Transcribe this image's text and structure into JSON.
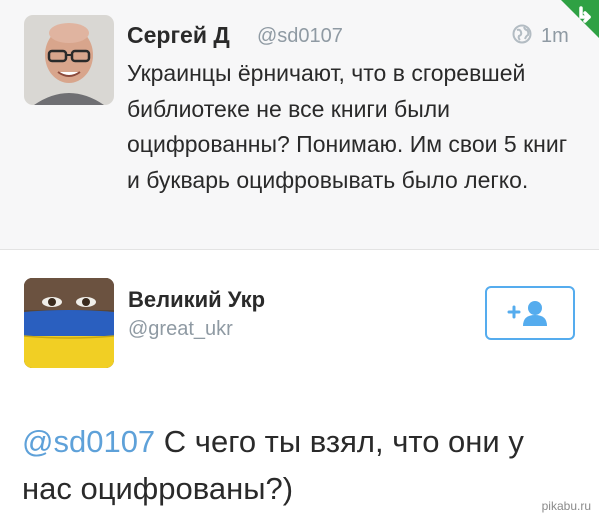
{
  "tweet1": {
    "author_name": "Сергей Д",
    "author_handle": "@sd0107",
    "time": "1m",
    "text": "Украинцы ёрничают, что в сгоревшей библиотеке не все книги были оцифрованны? Понимаю. Им свои 5 книг и букварь оцифровывать было легко."
  },
  "tweet2": {
    "author_name": "Великий Укр",
    "author_handle": "@great_ukr",
    "mention": "@sd0107",
    "text": " С чего ты взял, что они у нас оцифрованы?)"
  },
  "watermark": "pikabu.ru",
  "colors": {
    "accent": "#55acee",
    "corner_badge": "#2fa144",
    "ua_blue": "#2a5fbf",
    "ua_yellow": "#f1cf24"
  }
}
